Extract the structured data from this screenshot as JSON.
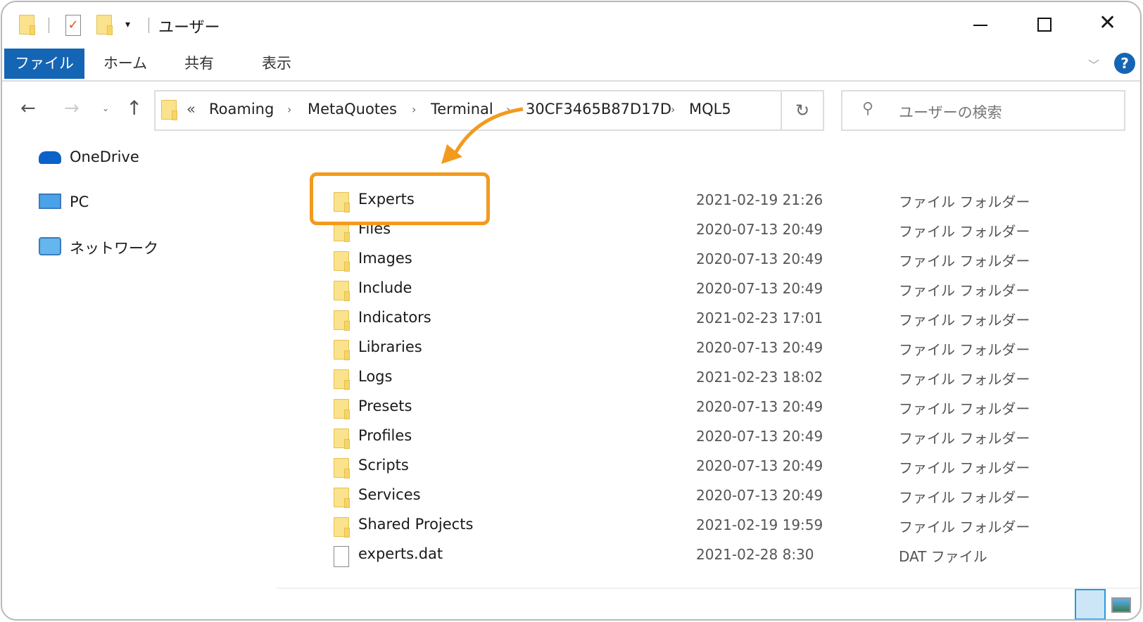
{
  "title": "ユーザー",
  "window_controls": {
    "minimize": "minimize",
    "maximize": "maximize",
    "close": "close"
  },
  "ribbon": {
    "tabs": [
      {
        "label": "ファイル",
        "active": true
      },
      {
        "label": "ホーム"
      },
      {
        "label": "共有"
      },
      {
        "label": "表示"
      }
    ],
    "accent": "#1565b5"
  },
  "address": {
    "overflow": "«",
    "crumbs": [
      "Roaming",
      "MetaQuotes",
      "Terminal",
      "30CF3465B87D17D",
      "MQL5"
    ]
  },
  "search": {
    "placeholder": "ユーザーの検索"
  },
  "sidebar": {
    "items": [
      {
        "label": "OneDrive",
        "icon": "cloud-icon"
      },
      {
        "label": "PC",
        "icon": "monitor-icon"
      },
      {
        "label": "ネットワーク",
        "icon": "network-icon"
      }
    ]
  },
  "files": [
    {
      "name": "Experts",
      "date": "2021-02-19 21:26",
      "type": "ファイル フォルダー",
      "kind": "folder",
      "highlighted": true
    },
    {
      "name": "Files",
      "date": "2020-07-13 20:49",
      "type": "ファイル フォルダー",
      "kind": "folder"
    },
    {
      "name": "Images",
      "date": "2020-07-13 20:49",
      "type": "ファイル フォルダー",
      "kind": "folder"
    },
    {
      "name": "Include",
      "date": "2020-07-13 20:49",
      "type": "ファイル フォルダー",
      "kind": "folder"
    },
    {
      "name": "Indicators",
      "date": "2021-02-23 17:01",
      "type": "ファイル フォルダー",
      "kind": "folder"
    },
    {
      "name": "Libraries",
      "date": "2020-07-13 20:49",
      "type": "ファイル フォルダー",
      "kind": "folder"
    },
    {
      "name": "Logs",
      "date": "2021-02-23 18:02",
      "type": "ファイル フォルダー",
      "kind": "folder"
    },
    {
      "name": "Presets",
      "date": "2020-07-13 20:49",
      "type": "ファイル フォルダー",
      "kind": "folder"
    },
    {
      "name": "Profiles",
      "date": "2020-07-13 20:49",
      "type": "ファイル フォルダー",
      "kind": "folder"
    },
    {
      "name": "Scripts",
      "date": "2020-07-13 20:49",
      "type": "ファイル フォルダー",
      "kind": "folder"
    },
    {
      "name": "Services",
      "date": "2020-07-13 20:49",
      "type": "ファイル フォルダー",
      "kind": "folder"
    },
    {
      "name": "Shared Projects",
      "date": "2021-02-19 19:59",
      "type": "ファイル フォルダー",
      "kind": "folder"
    },
    {
      "name": "experts.dat",
      "date": "2021-02-28 8:30",
      "type": "DAT ファイル",
      "kind": "file"
    }
  ],
  "highlight_color": "#f39a1e",
  "view": {
    "active": "details"
  }
}
